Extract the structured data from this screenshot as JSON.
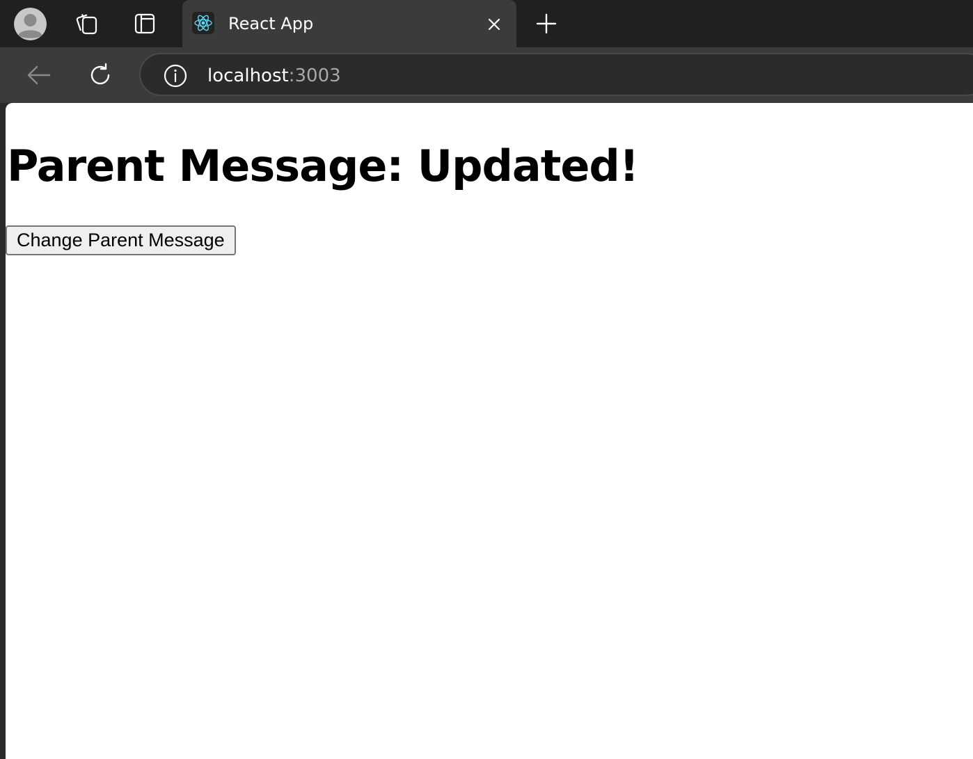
{
  "browser": {
    "tab": {
      "title": "React App",
      "favicon": "react-logo-icon"
    },
    "toolbar": {
      "url_host": "localhost",
      "url_port": ":3003"
    },
    "icons": {
      "profile": "profile-avatar-icon",
      "collections": "collections-icon",
      "sidebar": "sidebar-toggle-icon",
      "close": "close-icon",
      "new_tab": "plus-icon",
      "back": "back-arrow-icon",
      "reload": "reload-icon",
      "info": "info-icon"
    },
    "colors": {
      "tabstrip": "#202020",
      "active_tab": "#3b3b3b",
      "react_cyan": "#61dafb"
    }
  },
  "page": {
    "heading": "Parent Message: Updated!",
    "button_label": "Change Parent Message"
  }
}
